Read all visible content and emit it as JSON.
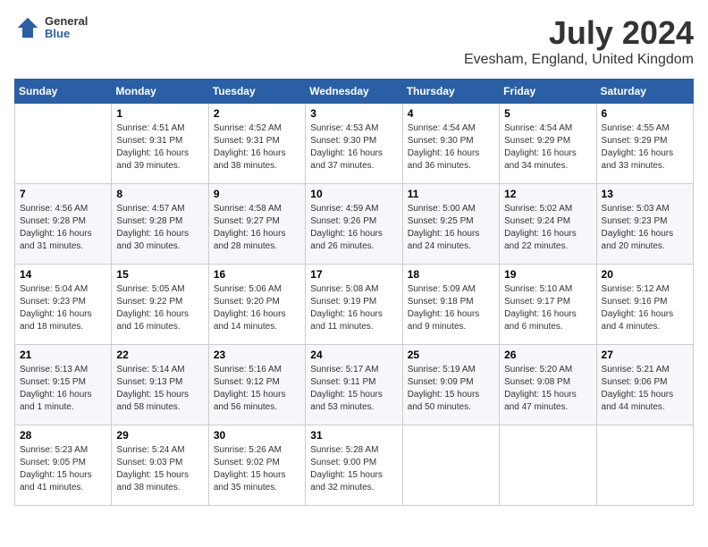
{
  "logo": {
    "general": "General",
    "blue": "Blue"
  },
  "title": "July 2024",
  "location": "Evesham, England, United Kingdom",
  "days_of_week": [
    "Sunday",
    "Monday",
    "Tuesday",
    "Wednesday",
    "Thursday",
    "Friday",
    "Saturday"
  ],
  "weeks": [
    [
      {
        "day": "",
        "info": ""
      },
      {
        "day": "1",
        "info": "Sunrise: 4:51 AM\nSunset: 9:31 PM\nDaylight: 16 hours\nand 39 minutes."
      },
      {
        "day": "2",
        "info": "Sunrise: 4:52 AM\nSunset: 9:31 PM\nDaylight: 16 hours\nand 38 minutes."
      },
      {
        "day": "3",
        "info": "Sunrise: 4:53 AM\nSunset: 9:30 PM\nDaylight: 16 hours\nand 37 minutes."
      },
      {
        "day": "4",
        "info": "Sunrise: 4:54 AM\nSunset: 9:30 PM\nDaylight: 16 hours\nand 36 minutes."
      },
      {
        "day": "5",
        "info": "Sunrise: 4:54 AM\nSunset: 9:29 PM\nDaylight: 16 hours\nand 34 minutes."
      },
      {
        "day": "6",
        "info": "Sunrise: 4:55 AM\nSunset: 9:29 PM\nDaylight: 16 hours\nand 33 minutes."
      }
    ],
    [
      {
        "day": "7",
        "info": "Sunrise: 4:56 AM\nSunset: 9:28 PM\nDaylight: 16 hours\nand 31 minutes."
      },
      {
        "day": "8",
        "info": "Sunrise: 4:57 AM\nSunset: 9:28 PM\nDaylight: 16 hours\nand 30 minutes."
      },
      {
        "day": "9",
        "info": "Sunrise: 4:58 AM\nSunset: 9:27 PM\nDaylight: 16 hours\nand 28 minutes."
      },
      {
        "day": "10",
        "info": "Sunrise: 4:59 AM\nSunset: 9:26 PM\nDaylight: 16 hours\nand 26 minutes."
      },
      {
        "day": "11",
        "info": "Sunrise: 5:00 AM\nSunset: 9:25 PM\nDaylight: 16 hours\nand 24 minutes."
      },
      {
        "day": "12",
        "info": "Sunrise: 5:02 AM\nSunset: 9:24 PM\nDaylight: 16 hours\nand 22 minutes."
      },
      {
        "day": "13",
        "info": "Sunrise: 5:03 AM\nSunset: 9:23 PM\nDaylight: 16 hours\nand 20 minutes."
      }
    ],
    [
      {
        "day": "14",
        "info": "Sunrise: 5:04 AM\nSunset: 9:23 PM\nDaylight: 16 hours\nand 18 minutes."
      },
      {
        "day": "15",
        "info": "Sunrise: 5:05 AM\nSunset: 9:22 PM\nDaylight: 16 hours\nand 16 minutes."
      },
      {
        "day": "16",
        "info": "Sunrise: 5:06 AM\nSunset: 9:20 PM\nDaylight: 16 hours\nand 14 minutes."
      },
      {
        "day": "17",
        "info": "Sunrise: 5:08 AM\nSunset: 9:19 PM\nDaylight: 16 hours\nand 11 minutes."
      },
      {
        "day": "18",
        "info": "Sunrise: 5:09 AM\nSunset: 9:18 PM\nDaylight: 16 hours\nand 9 minutes."
      },
      {
        "day": "19",
        "info": "Sunrise: 5:10 AM\nSunset: 9:17 PM\nDaylight: 16 hours\nand 6 minutes."
      },
      {
        "day": "20",
        "info": "Sunrise: 5:12 AM\nSunset: 9:16 PM\nDaylight: 16 hours\nand 4 minutes."
      }
    ],
    [
      {
        "day": "21",
        "info": "Sunrise: 5:13 AM\nSunset: 9:15 PM\nDaylight: 16 hours\nand 1 minute."
      },
      {
        "day": "22",
        "info": "Sunrise: 5:14 AM\nSunset: 9:13 PM\nDaylight: 15 hours\nand 58 minutes."
      },
      {
        "day": "23",
        "info": "Sunrise: 5:16 AM\nSunset: 9:12 PM\nDaylight: 15 hours\nand 56 minutes."
      },
      {
        "day": "24",
        "info": "Sunrise: 5:17 AM\nSunset: 9:11 PM\nDaylight: 15 hours\nand 53 minutes."
      },
      {
        "day": "25",
        "info": "Sunrise: 5:19 AM\nSunset: 9:09 PM\nDaylight: 15 hours\nand 50 minutes."
      },
      {
        "day": "26",
        "info": "Sunrise: 5:20 AM\nSunset: 9:08 PM\nDaylight: 15 hours\nand 47 minutes."
      },
      {
        "day": "27",
        "info": "Sunrise: 5:21 AM\nSunset: 9:06 PM\nDaylight: 15 hours\nand 44 minutes."
      }
    ],
    [
      {
        "day": "28",
        "info": "Sunrise: 5:23 AM\nSunset: 9:05 PM\nDaylight: 15 hours\nand 41 minutes."
      },
      {
        "day": "29",
        "info": "Sunrise: 5:24 AM\nSunset: 9:03 PM\nDaylight: 15 hours\nand 38 minutes."
      },
      {
        "day": "30",
        "info": "Sunrise: 5:26 AM\nSunset: 9:02 PM\nDaylight: 15 hours\nand 35 minutes."
      },
      {
        "day": "31",
        "info": "Sunrise: 5:28 AM\nSunset: 9:00 PM\nDaylight: 15 hours\nand 32 minutes."
      },
      {
        "day": "",
        "info": ""
      },
      {
        "day": "",
        "info": ""
      },
      {
        "day": "",
        "info": ""
      }
    ]
  ]
}
